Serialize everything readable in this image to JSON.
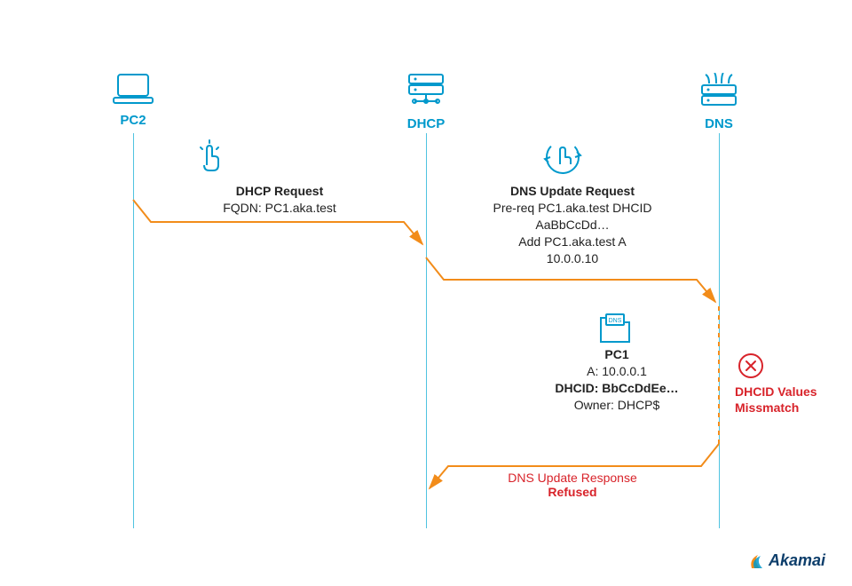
{
  "actors": {
    "pc2_label": "PC2",
    "dhcp_label": "DHCP",
    "dns_label": "DNS"
  },
  "msg1": {
    "title": "DHCP Request",
    "line1": "FQDN: PC1.aka.test"
  },
  "msg2": {
    "title": "DNS Update Request",
    "line1": "Pre-req PC1.aka.test DHCID",
    "line2": "AaBbCcDd…",
    "line3": "Add PC1.aka.test A",
    "line4": "10.0.0.10"
  },
  "dns_record": {
    "name": "PC1",
    "a_label": "A: 10.0.0.1",
    "dhcid_label": "DHCID: BbCcDdEe…",
    "owner_label": "Owner: DHCP$"
  },
  "mismatch": {
    "line1": "DHCID Values",
    "line2": "Missmatch"
  },
  "response": {
    "line1": "DNS Update Response",
    "line2": "Refused"
  },
  "brand": "Akamai",
  "colors": {
    "akamai_blue": "#0099cc",
    "arrow_orange": "#f28c1a",
    "error_red": "#d8232a"
  }
}
